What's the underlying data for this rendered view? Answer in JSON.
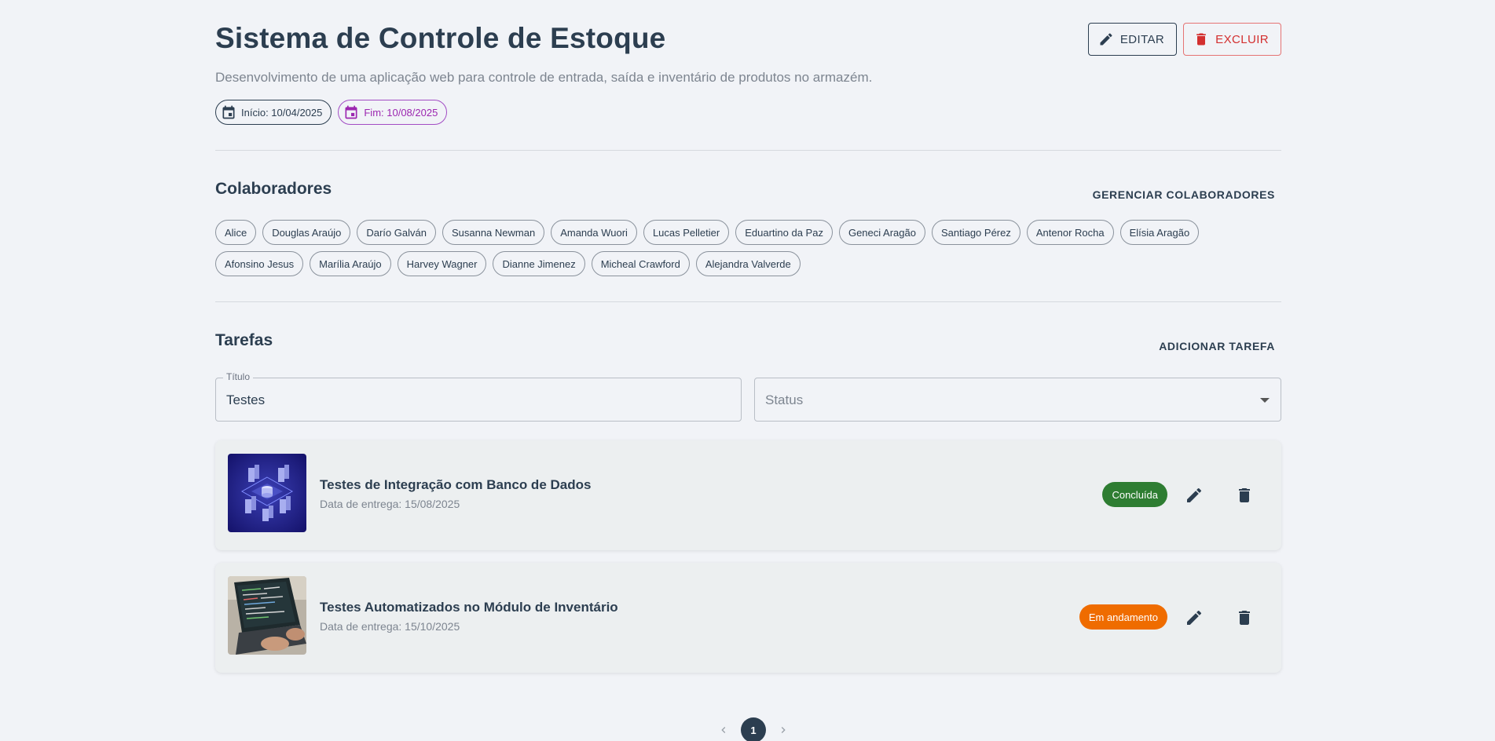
{
  "header": {
    "title": "Sistema de Controle de Estoque",
    "description": "Desenvolvimento de uma aplicação web para controle de entrada, saída e inventário de produtos no armazém.",
    "start_label": "Início: 10/04/2025",
    "end_label": "Fim: 10/08/2025",
    "edit_label": "EDITAR",
    "delete_label": "EXCLUIR"
  },
  "collaborators": {
    "title": "Colaboradores",
    "manage_label": "GERENCIAR COLABORADORES",
    "names": [
      "Alice",
      "Douglas Araújo",
      "Darío Galván",
      "Susanna Newman",
      "Amanda Wuori",
      "Lucas Pelletier",
      "Eduartino da Paz",
      "Geneci Aragão",
      "Santiago Pérez",
      "Antenor Rocha",
      "Elísia Aragão",
      "Afonsino Jesus",
      "Marília Araújo",
      "Harvey Wagner",
      "Dianne Jimenez",
      "Micheal Crawford",
      "Alejandra Valverde"
    ]
  },
  "tasks": {
    "title": "Tarefas",
    "add_label": "ADICIONAR TAREFA",
    "filter_title_label": "Título",
    "filter_title_value": "Testes",
    "filter_status_placeholder": "Status",
    "items": [
      {
        "title": "Testes de Integração com Banco de Dados",
        "date": "Data de entrega: 15/08/2025",
        "status": "Concluída",
        "status_color": "#2e7d32"
      },
      {
        "title": "Testes Automatizados no Módulo de Inventário",
        "date": "Data de entrega: 15/10/2025",
        "status": "Em andamento",
        "status_color": "#ef6c00"
      }
    ]
  },
  "pagination": {
    "current": "1"
  },
  "colors": {
    "primary": "#2c3e50",
    "danger": "#d32f2f",
    "end_date": "#9c27b0"
  }
}
